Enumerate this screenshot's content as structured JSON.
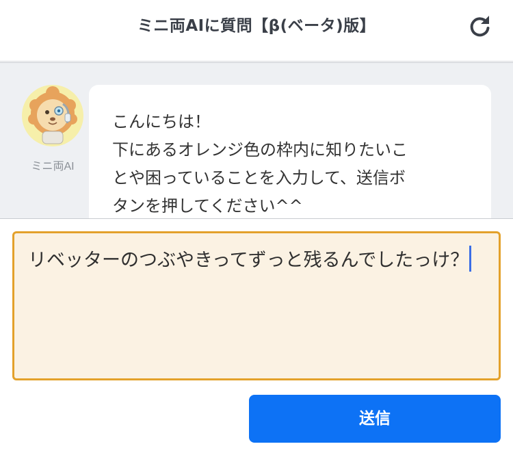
{
  "header": {
    "title": "ミニ両AIに質問【β(ベータ)版】",
    "reload_icon": "reload-icon"
  },
  "chat": {
    "assistant_name": "ミニ両AI",
    "avatar_icon": "lion-mascot-avatar",
    "message_lines": [
      "こんにちは！",
      "下にあるオレンジ色の枠内に知りたいこ",
      "とや困っていることを入力して、送信ボ",
      "タンを押してください^^"
    ]
  },
  "composer": {
    "input_value": "リベッターのつぶやきってずっと残るんでしたっけ？",
    "send_label": "送信"
  },
  "colors": {
    "accent_blue": "#0d72f5",
    "input_border_orange": "#e3a12b",
    "input_background": "#fbf2e3",
    "chat_background": "#eef0f3"
  }
}
